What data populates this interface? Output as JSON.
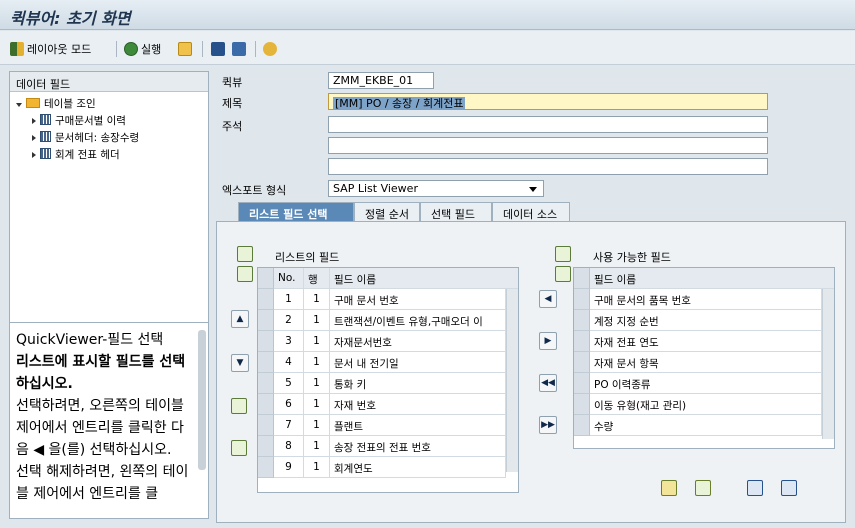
{
  "title": "퀵뷰어: 초기 화면",
  "toolbar": {
    "layout_mode": "레이아웃 모드",
    "execute": "실행"
  },
  "left": {
    "header": "데이터 필드",
    "root": "테이블 조인",
    "items": [
      "구매문서별 이력",
      "문서헤더: 송장수령",
      "회계 전표 헤더"
    ]
  },
  "help": {
    "heading": "QuickViewer-필드 선택",
    "bold": "리스트에 표시할 필드를 선택하십시오.",
    "p1": "선택하려면, 오른쪽의 테이블 제어에서 엔트리를 클릭한 다음 ◀ 을(를) 선택하십시오.",
    "p2": "선택 해제하려면, 왼쪽의 테이블 제어에서 엔트리를 클"
  },
  "form": {
    "quickview_label": "퀵뷰",
    "quickview_value": "ZMM_EKBE_01",
    "title_label": "제목",
    "title_value": "[MM] PO / 송장 / 회계전표",
    "note_label": "주석",
    "export_label": "엑스포트 형식",
    "export_value": "SAP List Viewer"
  },
  "tabs": [
    "리스트 필드 선택",
    "정렬 순서",
    "선택 필드",
    "데이터 소스"
  ],
  "list_fields": {
    "title": "리스트의 필드",
    "headers": [
      "No.",
      "행",
      "필드 이름"
    ],
    "rows": [
      [
        "1",
        "1",
        "구매 문서 번호"
      ],
      [
        "2",
        "1",
        "트랜잭션/이벤트 유형,구매오더 이"
      ],
      [
        "3",
        "1",
        "자재문서번호"
      ],
      [
        "4",
        "1",
        "문서 내 전기일"
      ],
      [
        "5",
        "1",
        "통화 키"
      ],
      [
        "6",
        "1",
        "자재 번호"
      ],
      [
        "7",
        "1",
        "플랜트"
      ],
      [
        "8",
        "1",
        "송장 전표의 전표 번호"
      ],
      [
        "9",
        "1",
        "회계연도"
      ]
    ]
  },
  "avail_fields": {
    "title": "사용 가능한 필드",
    "header": "필드 이름",
    "rows": [
      "구매 문서의 품목 번호",
      "계정 지정 순번",
      "자재 전표 연도",
      "자재 문서 항목",
      "PO 이력종류",
      "이동 유형(재고 관리)",
      "수량"
    ]
  },
  "colors": {
    "accent": "#5a89b8",
    "highlight": "#fff3a0"
  }
}
